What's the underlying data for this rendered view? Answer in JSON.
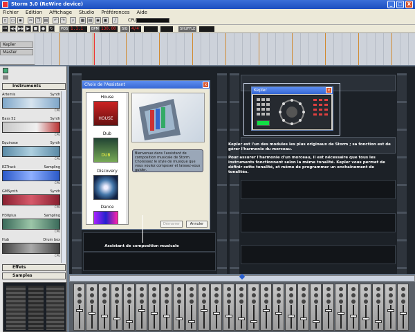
{
  "window": {
    "title": "Storm 3.0 (ReWire device)",
    "min": "_",
    "max": "□",
    "close": "X"
  },
  "menu": [
    "Fichier",
    "Edition",
    "Affichage",
    "Studio",
    "Préférences",
    "Aide"
  ],
  "toolbar": {
    "cpu_label": "CPU",
    "pos_display": "1.1.1",
    "tempo_display": "130.00",
    "sig_display": "4/4",
    "shuffle_label": "SHUFFLE"
  },
  "timeline": {
    "tracks": [
      "Kepler",
      "Master"
    ]
  },
  "browser": {
    "instruments_tab": "Instruments",
    "effects_tab": "Effets",
    "samples_tab": "Samples",
    "items": [
      {
        "name": "Artemis",
        "type": "Synth",
        "cpu": "CPU"
      },
      {
        "name": "Bass 52",
        "type": "Synth",
        "cpu": "CPU"
      },
      {
        "name": "Equinoxe",
        "type": "Synth",
        "cpu": "CPU"
      },
      {
        "name": "EZTrack",
        "type": "Sampling",
        "cpu": "CPU"
      },
      {
        "name": "GMSynth",
        "type": "Synth",
        "cpu": "CPU"
      },
      {
        "name": "H30plus",
        "type": "Sampling",
        "cpu": "CPU"
      },
      {
        "name": "Hub",
        "type": "Drum box",
        "cpu": "CPU"
      }
    ]
  },
  "assistant": {
    "title": "Choix de l'Assistant",
    "styles": [
      "House",
      "Dub",
      "Discovery",
      "Dance"
    ],
    "thumb_text": [
      "HOUSE",
      "DUB",
      "",
      ""
    ],
    "welcome": "Bienvenue dans l'assistant de composition musicale de Storm. Choisissez le style de musique que vous voulez composer et laissez-vous guider.",
    "next_button": "Démarrer",
    "cancel_button": "Annuler"
  },
  "kepler": {
    "title": "Kepler"
  },
  "annotations": {
    "kepler_p1": "Kepler est l'un des modules les plus originaux de Storm ; sa fonction est de gérer l'harmonie du morceau.",
    "kepler_p2": "Pour assurer l'harmonie d'un morceau, il est nécessaire que tous les instruments fonctionnent selon la même tonalité. Kepler vous permet de définir cette tonalité, et même de programmer un enchaînement de tonalités.",
    "assistant_caption": "Assistant de composition musicale"
  },
  "colors": {
    "accent": "#3667d4",
    "rack": "#1c2127",
    "dialog": "#ece9d8"
  }
}
